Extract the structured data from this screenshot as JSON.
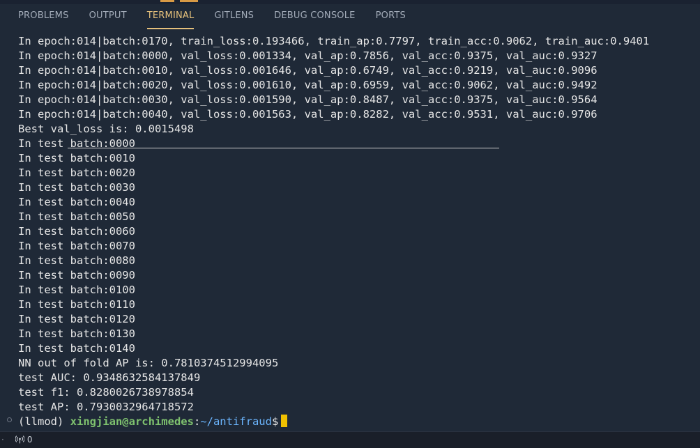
{
  "panel": {
    "tabs": [
      {
        "label": "PROBLEMS"
      },
      {
        "label": "OUTPUT"
      },
      {
        "label": "TERMINAL"
      },
      {
        "label": "GITLENS"
      },
      {
        "label": "DEBUG CONSOLE"
      },
      {
        "label": "PORTS"
      }
    ],
    "active_tab": "TERMINAL"
  },
  "terminal": {
    "lines": [
      "In epoch:014|batch:0170, train_loss:0.193466, train_ap:0.7797, train_acc:0.9062, train_auc:0.9401",
      "In epoch:014|batch:0000, val_loss:0.001334, val_ap:0.7856, val_acc:0.9375, val_auc:0.9327",
      "In epoch:014|batch:0010, val_loss:0.001646, val_ap:0.6749, val_acc:0.9219, val_auc:0.9096",
      "In epoch:014|batch:0020, val_loss:0.001610, val_ap:0.6959, val_acc:0.9062, val_auc:0.9492",
      "In epoch:014|batch:0030, val_loss:0.001590, val_ap:0.8487, val_acc:0.9375, val_auc:0.9564",
      "In epoch:014|batch:0040, val_loss:0.001563, val_ap:0.8282, val_acc:0.9531, val_auc:0.9706",
      "Best val_loss is: 0.0015498",
      "In test batch:0000",
      "In test batch:0010",
      "In test batch:0020",
      "In test batch:0030",
      "In test batch:0040",
      "In test batch:0050",
      "In test batch:0060",
      "In test batch:0070",
      "In test batch:0080",
      "In test batch:0090",
      "In test batch:0100",
      "In test batch:0110",
      "In test batch:0120",
      "In test batch:0130",
      "In test batch:0140",
      "NN out of fold AP is: 0.7810374512994095",
      "test AUC: 0.9348632584137849",
      "test f1: 0.8280026738978854",
      "test AP: 0.7930032964718572"
    ],
    "prompt": {
      "env": "(llmod) ",
      "user_host": "xingjian@archimedes",
      "separator": ":",
      "path": "~/antifraud",
      "symbol": "$"
    }
  },
  "statusbar": {
    "ports_count": "0"
  },
  "colors": {
    "background": "#1f2937",
    "active_tab": "#e5c07b",
    "user_host": "#7ec16e",
    "path": "#6cb6ff",
    "cursor": "#f0c000"
  }
}
